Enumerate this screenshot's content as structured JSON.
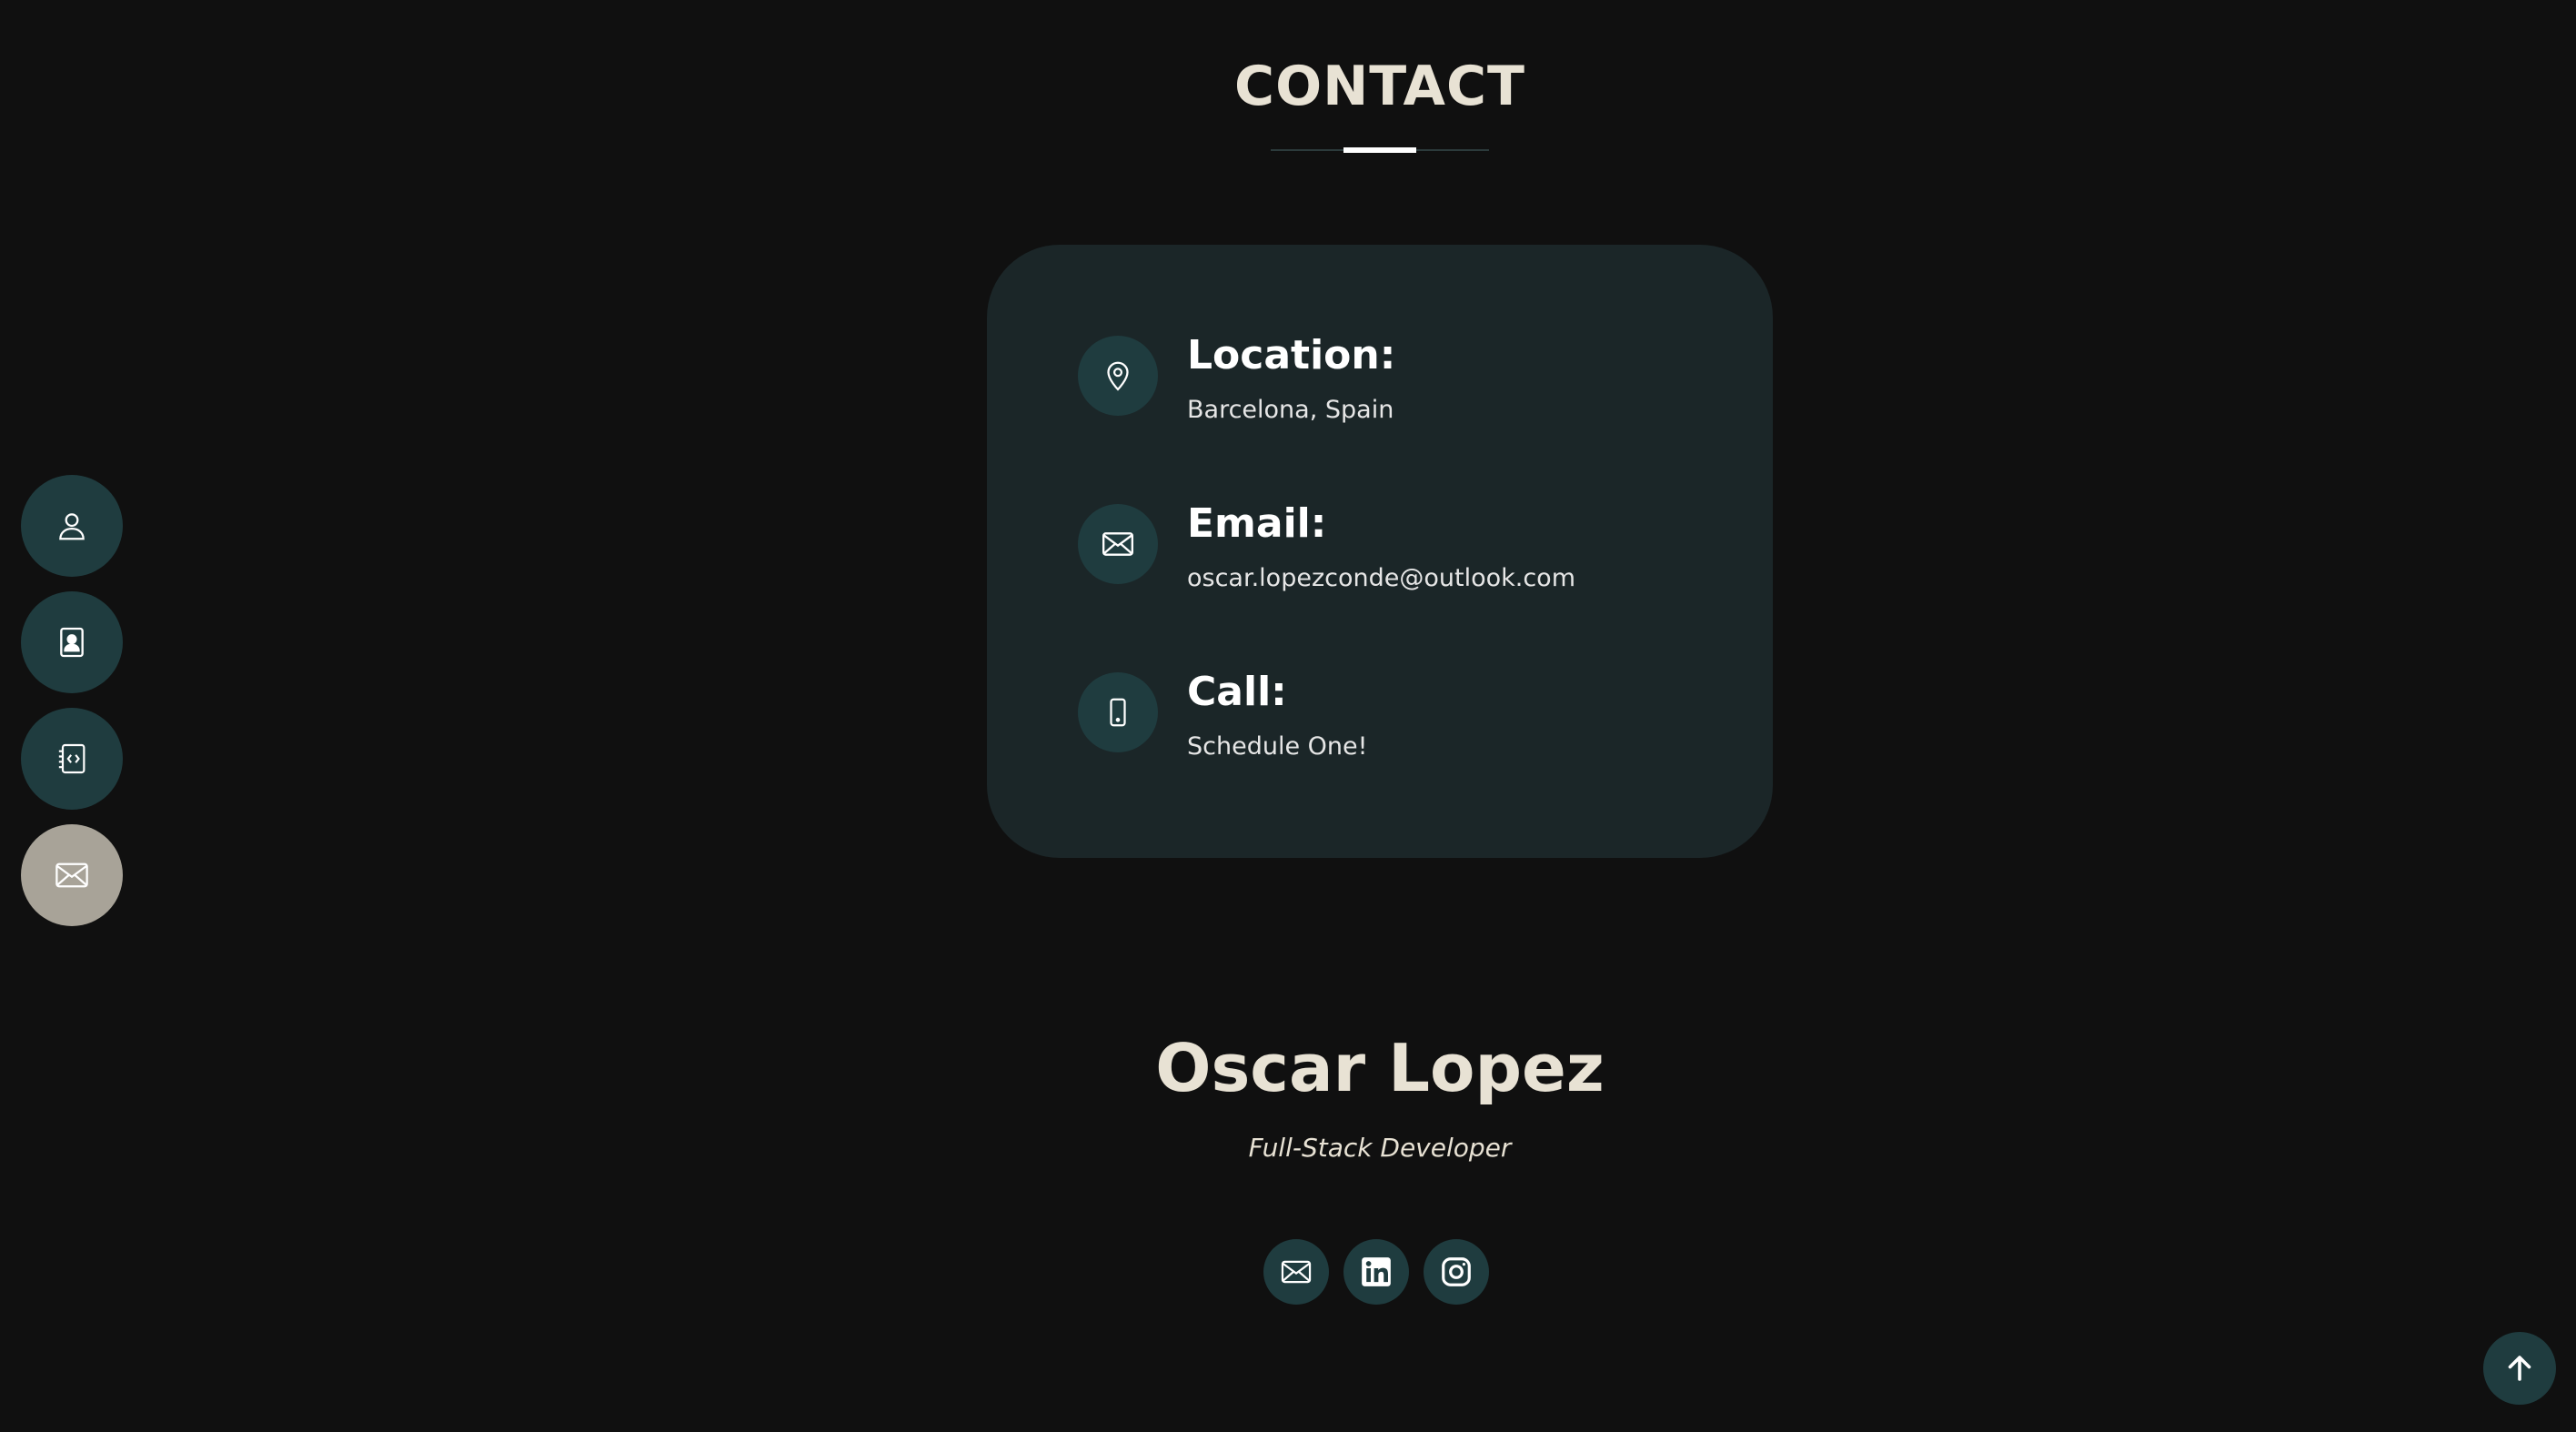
{
  "contact": {
    "title": "CONTACT",
    "items": [
      {
        "label": "Location:",
        "value": "Barcelona, Spain",
        "icon": "map-pin-icon"
      },
      {
        "label": "Email:",
        "value": "oscar.lopezconde@outlook.com",
        "icon": "envelope-icon"
      },
      {
        "label": "Call:",
        "value": "Schedule One!",
        "icon": "phone-icon"
      }
    ]
  },
  "side_nav": {
    "items": [
      {
        "icon": "person-icon",
        "active": false
      },
      {
        "icon": "resume-icon",
        "active": false
      },
      {
        "icon": "code-icon",
        "active": false
      },
      {
        "icon": "envelope-icon",
        "active": true
      }
    ]
  },
  "footer": {
    "name": "Oscar Lopez",
    "role": "Full-Stack Developer",
    "social": [
      {
        "icon": "envelope-icon"
      },
      {
        "icon": "linkedin-icon"
      },
      {
        "icon": "instagram-icon"
      }
    ]
  },
  "back_to_top": {
    "icon": "arrow-up-icon"
  },
  "colors": {
    "background": "#101010",
    "card": "#1b2628",
    "accent": "#1f3c3f",
    "active": "#a8a398",
    "heading": "#e8e2d4"
  }
}
